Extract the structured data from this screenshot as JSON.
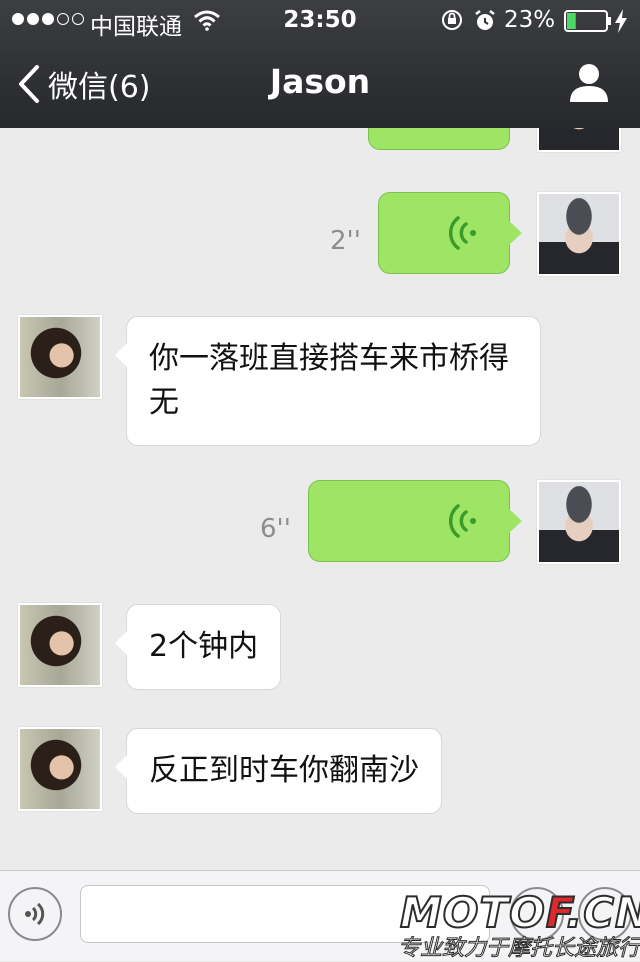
{
  "status_bar": {
    "carrier": "中国联通",
    "time": "23:50",
    "battery_percent": "23%",
    "battery_level": 0.23,
    "signal_bars_on": 3,
    "signal_bars_total": 5
  },
  "nav": {
    "back_label": "微信(6)",
    "title": "Jason"
  },
  "messages": [
    {
      "from": "me",
      "type": "voice",
      "duration": ""
    },
    {
      "from": "me",
      "type": "voice",
      "duration": "2''"
    },
    {
      "from": "contact",
      "type": "text",
      "text": "你一落班直接搭车来市桥得无"
    },
    {
      "from": "me",
      "type": "voice",
      "duration": "6''"
    },
    {
      "from": "contact",
      "type": "text",
      "text": "2个钟内"
    },
    {
      "from": "contact",
      "type": "text",
      "text": "反正到时车你翻南沙"
    }
  ],
  "input": {
    "placeholder": ""
  },
  "watermark": {
    "brand_prefix": "MOTO",
    "brand_mid": "F",
    "brand_suffix": ".CN",
    "tagline": "专业致力于摩托长途旅行"
  },
  "icons": {
    "back": "chevron-left-icon",
    "contact": "person-icon",
    "voice_message": "voice-wave-icon",
    "voice_toggle": "speaker-icon",
    "wifi": "wifi-icon",
    "lock": "rotation-lock-icon",
    "alarm": "alarm-icon",
    "charge": "charging-bolt-icon"
  },
  "colors": {
    "nav_bg": "#2f3135",
    "outgoing_bubble": "#9ee565",
    "incoming_bubble": "#ffffff",
    "chat_bg": "#ebebeb",
    "battery_fill": "#4cd964"
  }
}
